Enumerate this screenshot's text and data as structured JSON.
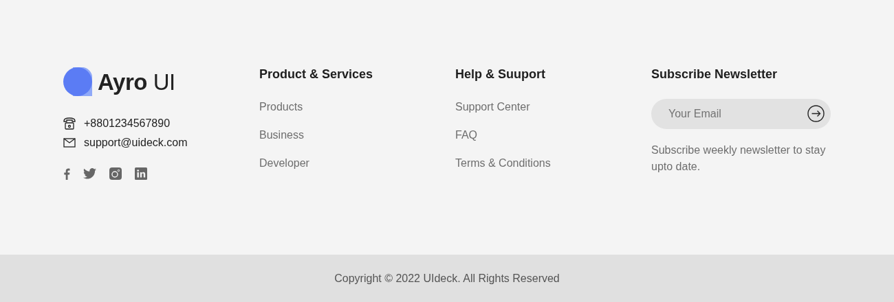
{
  "brand": {
    "logo_text": "**Ayro** UI"
  },
  "contact": [
    {
      "kind": "phone",
      "text": "+8801234567890"
    },
    {
      "kind": "email",
      "text": "support@uideck.com"
    }
  ],
  "social": [
    {
      "kind": "facebook"
    },
    {
      "kind": "twitter"
    },
    {
      "kind": "instagram"
    },
    {
      "kind": "linkedin"
    }
  ],
  "columns": [
    {
      "title": "Product & Services",
      "links": [
        "Products",
        "Business",
        "Developer"
      ]
    },
    {
      "title": "Help & Suuport",
      "links": [
        "Support Center",
        "FAQ",
        "Terms & Conditions"
      ]
    }
  ],
  "newsletter": {
    "title": "Subscribe Newsletter",
    "placeholder": "Your Email",
    "note": "Subscribe weekly newsletter to stay upto date."
  },
  "copyright": "Copyright © 2022 UIdeck. All Rights Reserved"
}
